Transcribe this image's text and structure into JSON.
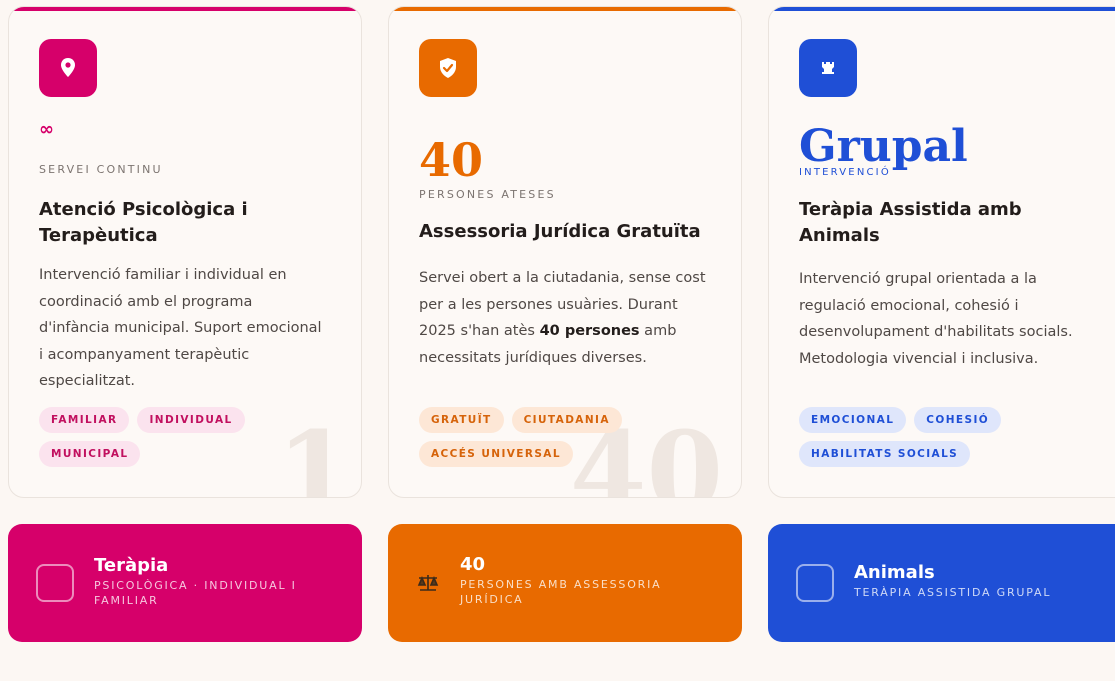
{
  "colors": {
    "magenta": "#d6006a",
    "orange": "#e86a00",
    "blue": "#1f4fd6"
  },
  "cards": [
    {
      "icon": "location-pin-icon",
      "stat": "∞",
      "label": "SERVEI CONTINU",
      "title": "Atenció Psicològica i Terapèutica",
      "description": "Intervenció familiar i individual en coordinació amb el programa d'infància municipal. Suport emocional i acompanyament terapèutic especialitzat.",
      "tags": [
        "FAMILIAR",
        "INDIVIDUAL",
        "MUNICIPAL"
      ],
      "watermark": "1"
    },
    {
      "icon": "shield-check-icon",
      "stat": "40",
      "label": "PERSONES ATESES",
      "title": "Assessoria Jurídica Gratuïta",
      "description_parts": [
        "Servei obert a la ciutadania, sense cost per a les persones usuàries. Durant 2025 s'han atès ",
        "40 persones",
        " amb necessitats jurídiques diverses."
      ],
      "tags": [
        "GRATUÏT",
        "CIUTADANIA",
        "ACCÉS UNIVERSAL"
      ],
      "watermark": "40"
    },
    {
      "icon": "rook-icon",
      "stat": "Grupal",
      "label": "INTERVENCIÓ",
      "title": "Teràpia Assistida amb Animals",
      "description": "Intervenció grupal orientada a la regulació emocional, cohesió i desenvolupament d'habilitats socials. Metodologia vivencial i inclusiva.",
      "tags": [
        "EMOCIONAL",
        "COHESIÓ",
        "HABILITATS SOCIALS"
      ]
    }
  ],
  "banners": [
    {
      "icon": "square-outline-icon",
      "title": "Teràpia",
      "subtitle": "PSICOLÒGICA · INDIVIDUAL I FAMILIAR"
    },
    {
      "icon": "scales-icon",
      "title": "40",
      "subtitle": "PERSONES AMB ASSESSORIA JURÍDICA"
    },
    {
      "icon": "square-outline-icon",
      "title": "Animals",
      "subtitle": "TERÀPIA ASSISTIDA GRUPAL"
    }
  ]
}
